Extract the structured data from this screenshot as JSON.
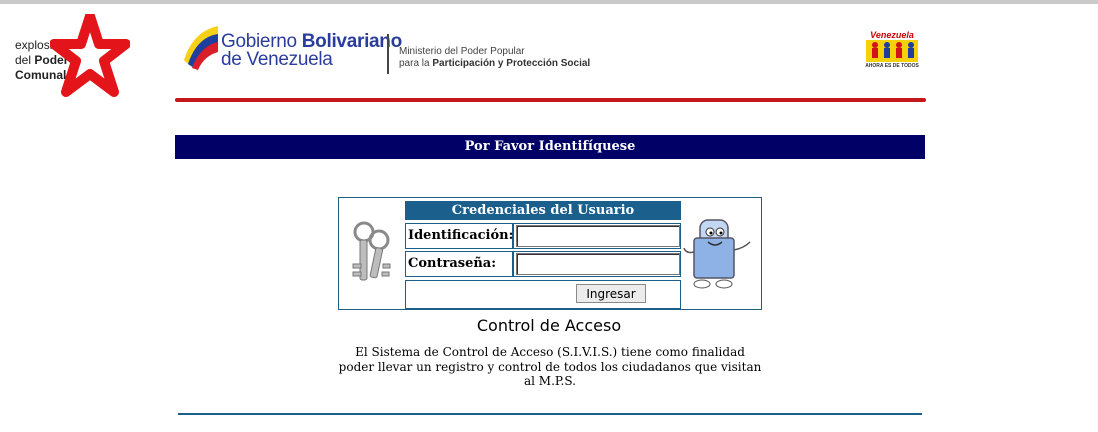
{
  "header": {
    "left_logo": {
      "line1": "explosión",
      "line2a": "del ",
      "line2b": "Poder",
      "line3": "Comunal"
    },
    "gov": {
      "name_part1": "Gobierno ",
      "name_bold": "Bolivariano",
      "name_line2": "de Venezuela",
      "ministry_line1": "Ministerio del Poder Popular",
      "ministry_line2_prefix": "para la ",
      "ministry_line2_bold": "Participación y Protección Social"
    },
    "right_logo": {
      "title": "Venezuela",
      "subtitle": "AHORA ES DE TODOS"
    }
  },
  "title_bar": "Por Favor Identifíquese",
  "login": {
    "header": "Credenciales del Usuario",
    "id_label": "Identificación:",
    "id_value": "",
    "password_label": "Contraseña:",
    "password_value": "",
    "submit_label": "Ingresar"
  },
  "footer": {
    "title": "Control de Acceso",
    "description_line1": "El Sistema de Control de Acceso (S.I.V.I.S.) tiene como finalidad",
    "description_line2": "poder llevar un registro y control de todos los ciudadanos que visitan",
    "description_line3": "al M.P.S."
  },
  "colors": {
    "title_bar": "#000066",
    "credentials_header": "#1b5f8d",
    "red_rule": "#c4171c",
    "gov_text": "#2b3d9c"
  }
}
